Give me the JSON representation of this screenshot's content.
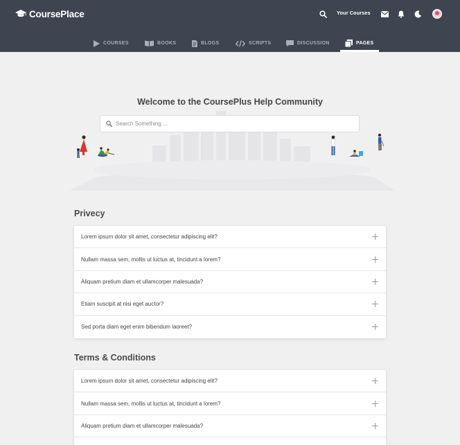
{
  "brand": {
    "name": "CoursePlace"
  },
  "header": {
    "your_courses": "Your Courses"
  },
  "nav": {
    "items": [
      {
        "label": "COURSES",
        "icon": "play-icon"
      },
      {
        "label": "BOOKS",
        "icon": "book-icon"
      },
      {
        "label": "BLOGS",
        "icon": "document-icon"
      },
      {
        "label": "SCRIPTS",
        "icon": "code-icon"
      },
      {
        "label": "DISCUSSION",
        "icon": "chat-icon"
      },
      {
        "label": "PAGES",
        "icon": "pages-icon"
      }
    ],
    "active": "PAGES"
  },
  "hero": {
    "title": "Welcome to the CoursePlus Help Community",
    "search_placeholder": "Search Something ..."
  },
  "sections": [
    {
      "title": "Privecy",
      "items": [
        "Lorem ipsum dolor sit amet, consectetur adipiscing elit?",
        "Nullam massa sem, mollis ut luctus at, tincidunt a lorem?",
        "Aliquam pretium diam et ullamcorper malesuada?",
        "Etiam suscipit at nisi eget auctor?",
        "Sed porta diam eget enim bibendum laoreet?"
      ]
    },
    {
      "title": "Terms & Conditions",
      "items": [
        "Lorem ipsum dolor sit amet, consectetur adipiscing elit?",
        "Nullam massa sem, mollis ut luctus at, tincidunt a lorem?",
        "Aliquam pretium diam et ullamcorper malesuada?",
        ""
      ]
    }
  ],
  "colors": {
    "header_bg": "#3e4551",
    "page_bg": "#f0f0f1",
    "nav_inactive": "#a8aeb7",
    "illustration_red": "#d9362b",
    "illustration_blue": "#2f5fa8"
  }
}
